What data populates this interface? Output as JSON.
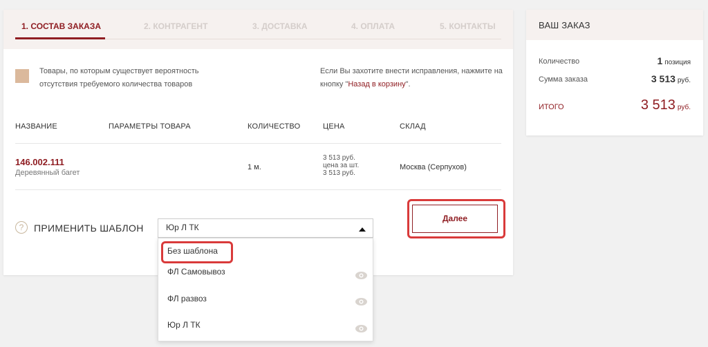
{
  "tabs": [
    {
      "label": "1. СОСТАВ ЗАКАЗА"
    },
    {
      "label": "2. КОНТРАГЕНТ"
    },
    {
      "label": "3. ДОСТАВКА"
    },
    {
      "label": "4. ОПЛАТА"
    },
    {
      "label": "5. КОНТАКТЫ"
    }
  ],
  "legend": {
    "swatch_color": "#dbb99c",
    "text": "Товары, по которым существует вероятность отсутствия требуемого количества товаров"
  },
  "notice": {
    "text_before": "Если Вы захотите внести исправления, нажмите на кнопку \"",
    "link": "Назад в корзину",
    "text_after": "\"."
  },
  "table": {
    "headers": [
      "НАЗВАНИЕ",
      "ПАРАМЕТРЫ ТОВАРА",
      "КОЛИЧЕСТВО",
      "ЦЕНА",
      "СКЛАД"
    ],
    "rows": [
      {
        "code": "146.002.111",
        "name": "Деревянный багет",
        "params": "",
        "quantity": "1 м.",
        "price_line1": "3 513 руб.",
        "price_line2": "цена за шт.",
        "price_line3": "3 513 руб.",
        "stock": "Москва (Серпухов)"
      }
    ]
  },
  "template": {
    "label": "ПРИМЕНИТЬ ШАБЛОН",
    "selected": "Юр Л ТК",
    "options": [
      {
        "label": "Без шаблона",
        "icon": "none"
      },
      {
        "label": "ФЛ Самовывоз",
        "icon": "eye-icon"
      },
      {
        "label": "ФЛ развоз",
        "icon": "eye-icon"
      },
      {
        "label": "Юр Л ТК",
        "icon": "eye-icon"
      }
    ]
  },
  "next_button": {
    "label": "Далее"
  },
  "summary": {
    "title": "ВАШ ЗАКАЗ",
    "quantity_label": "Количество",
    "quantity_value": "1",
    "quantity_unit": "позиция",
    "sum_label": "Сумма заказа",
    "sum_value": "3 513",
    "sum_unit": "руб.",
    "total_label": "ИТОГО",
    "total_value": "3 513",
    "total_unit": "руб."
  },
  "colors": {
    "accent": "#8f1d22",
    "highlight": "#d93a3a",
    "background": "#f1f1f1"
  }
}
